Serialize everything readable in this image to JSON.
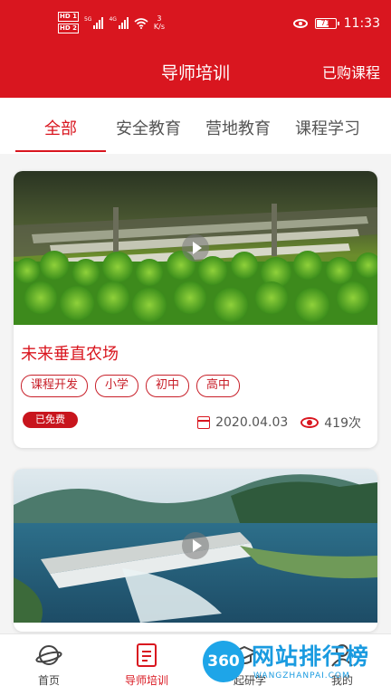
{
  "status_bar": {
    "hd1": "HD 1",
    "hd2": "HD 2",
    "sig1_tag": "5G",
    "sig2_tag": "4G",
    "net_speed_value": "3",
    "net_speed_unit": "K/s",
    "battery": "71",
    "battery_level": 0.71,
    "time": "11:33"
  },
  "header": {
    "title": "导师培训",
    "right_link": "已购课程"
  },
  "tabs": [
    {
      "label": "全部",
      "active": true
    },
    {
      "label": "安全教育",
      "active": false
    },
    {
      "label": "营地教育",
      "active": false
    },
    {
      "label": "课程学习",
      "active": false
    }
  ],
  "cards": [
    {
      "title": "未来垂直农场",
      "tags": [
        "课程开发",
        "小学",
        "初中",
        "高中"
      ],
      "badge": "已免费",
      "date": "2020.04.03",
      "views": "419次"
    },
    {
      "title": "",
      "tags": []
    }
  ],
  "bottom_nav": [
    {
      "label": "首页",
      "icon": "planet-icon",
      "active": false
    },
    {
      "label": "导师培训",
      "icon": "document-icon",
      "active": true
    },
    {
      "label": "一起研学",
      "icon": "graduation-cap-icon",
      "active": false
    },
    {
      "label": "我的",
      "icon": "user-icon",
      "active": false
    }
  ],
  "watermark": {
    "badge": "360",
    "text": "网站排行榜",
    "sub": "WANGZHANPAI.COM"
  },
  "colors": {
    "brand_red": "#d9161f",
    "tab_inactive": "#555555",
    "watermark_blue": "#1a9be0"
  }
}
